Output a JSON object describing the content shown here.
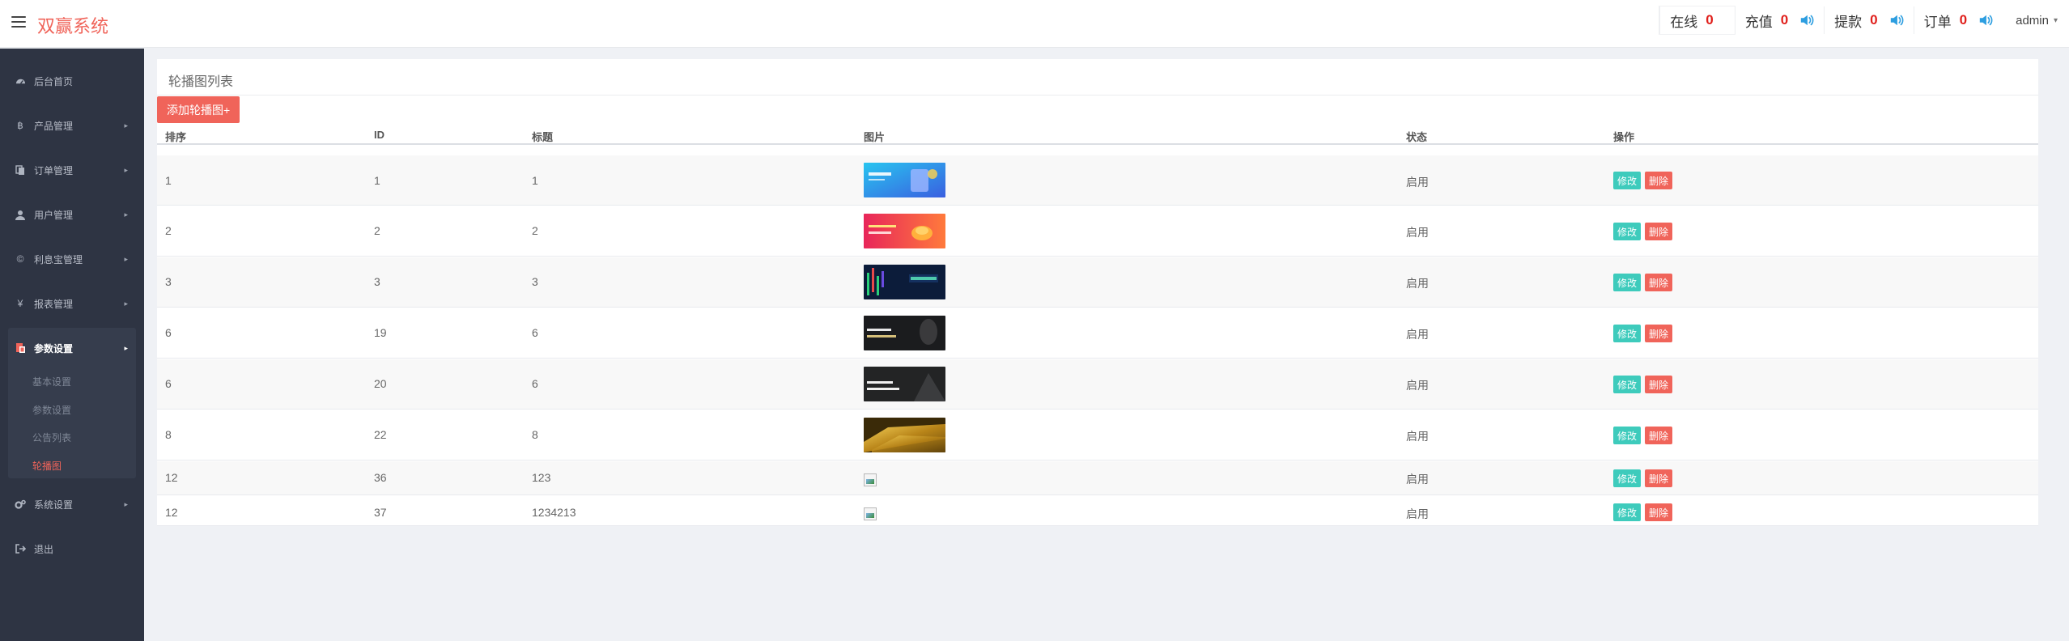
{
  "header": {
    "app_title": "双赢系统",
    "stats": [
      {
        "label": "在线",
        "count": "0",
        "speaker": false
      },
      {
        "label": "充值",
        "count": "0",
        "speaker": true
      },
      {
        "label": "提款",
        "count": "0",
        "speaker": true
      },
      {
        "label": "订单",
        "count": "0",
        "speaker": true
      }
    ],
    "user": "admin"
  },
  "sidebar": {
    "items": [
      {
        "label": "后台首页",
        "icon": "dashboard-icon",
        "has_arrow": false
      },
      {
        "label": "产品管理",
        "icon": "bitcoin-icon",
        "has_arrow": true
      },
      {
        "label": "订单管理",
        "icon": "copy-icon",
        "has_arrow": true
      },
      {
        "label": "用户管理",
        "icon": "user-icon",
        "has_arrow": true
      },
      {
        "label": "利息宝管理",
        "icon": "copyright-icon",
        "has_arrow": true
      },
      {
        "label": "报表管理",
        "icon": "yen-icon",
        "has_arrow": true
      },
      {
        "label": "参数设置",
        "icon": "settings-book-icon",
        "has_arrow": true,
        "active": true
      },
      {
        "label": "系统设置",
        "icon": "gears-icon",
        "has_arrow": true
      },
      {
        "label": "退出",
        "icon": "sign-out-icon",
        "has_arrow": false
      }
    ],
    "subitems": [
      {
        "label": "基本设置"
      },
      {
        "label": "参数设置"
      },
      {
        "label": "公告列表"
      },
      {
        "label": "轮播图",
        "current": true
      }
    ]
  },
  "panel": {
    "title": "轮播图列表",
    "add_button": "添加轮播图+",
    "columns": [
      "排序",
      "ID",
      "标题",
      "图片",
      "状态",
      "操作"
    ],
    "rows": [
      {
        "sort": "1",
        "id": "1",
        "title": "1",
        "image": "banner-blue",
        "status": "启用"
      },
      {
        "sort": "2",
        "id": "2",
        "title": "2",
        "image": "banner-red",
        "status": "启用"
      },
      {
        "sort": "3",
        "id": "3",
        "title": "3",
        "image": "banner-market",
        "status": "启用"
      },
      {
        "sort": "6",
        "id": "19",
        "title": "6",
        "image": "banner-dark-1",
        "status": "启用"
      },
      {
        "sort": "6",
        "id": "20",
        "title": "6",
        "image": "banner-dark-2",
        "status": "启用"
      },
      {
        "sort": "8",
        "id": "22",
        "title": "8",
        "image": "banner-gold",
        "status": "启用"
      },
      {
        "sort": "12",
        "id": "36",
        "title": "123",
        "image": "broken",
        "status": "启用"
      },
      {
        "sort": "12",
        "id": "37",
        "title": "1234213",
        "image": "broken",
        "status": "启用"
      }
    ],
    "edit_label": "修改",
    "delete_label": "删除"
  },
  "colors": {
    "accent": "#f0645a",
    "edit": "#3ecbbc",
    "sidebar_bg": "#2e3443",
    "count_red": "#e0201c",
    "speaker_blue": "#2d9ee0"
  }
}
